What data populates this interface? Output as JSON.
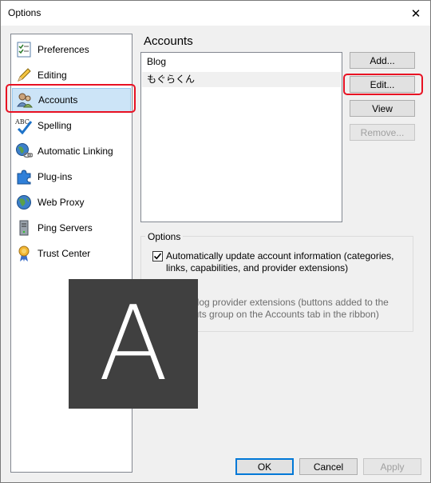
{
  "window": {
    "title": "Options",
    "close_glyph": "✕"
  },
  "sidebar": {
    "items": [
      {
        "label": "Preferences",
        "icon": "preferences-icon"
      },
      {
        "label": "Editing",
        "icon": "pencil-icon"
      },
      {
        "label": "Accounts",
        "icon": "accounts-icon",
        "selected": true
      },
      {
        "label": "Spelling",
        "icon": "spelling-icon"
      },
      {
        "label": "Automatic Linking",
        "icon": "globe-link-icon"
      },
      {
        "label": "Plug-ins",
        "icon": "puzzle-icon"
      },
      {
        "label": "Web Proxy",
        "icon": "globe-icon"
      },
      {
        "label": "Ping Servers",
        "icon": "server-icon"
      },
      {
        "label": "Trust Center",
        "icon": "ribbon-icon"
      }
    ]
  },
  "main": {
    "title": "Accounts",
    "accounts": [
      "Blog",
      "もぐらくん"
    ],
    "buttons": {
      "add": "Add...",
      "edit": "Edit...",
      "view": "View",
      "remove": "Remove..."
    },
    "options": {
      "group_label": "Options",
      "opt1": "Automatically update account information (categories, links, capabilities, and provider extensions)",
      "opt1_checked": true,
      "opt2": "Allow blog provider extensions (buttons added to the Shortcuts group on the Accounts tab in the ribbon)",
      "opt2_checked": true,
      "opt2_disabled": true
    }
  },
  "footer": {
    "ok": "OK",
    "cancel": "Cancel",
    "apply": "Apply"
  },
  "overlay": {
    "letter": "A"
  },
  "colors": {
    "highlight": "#e81123",
    "selection": "#cce4f7",
    "accent": "#0078d7"
  }
}
